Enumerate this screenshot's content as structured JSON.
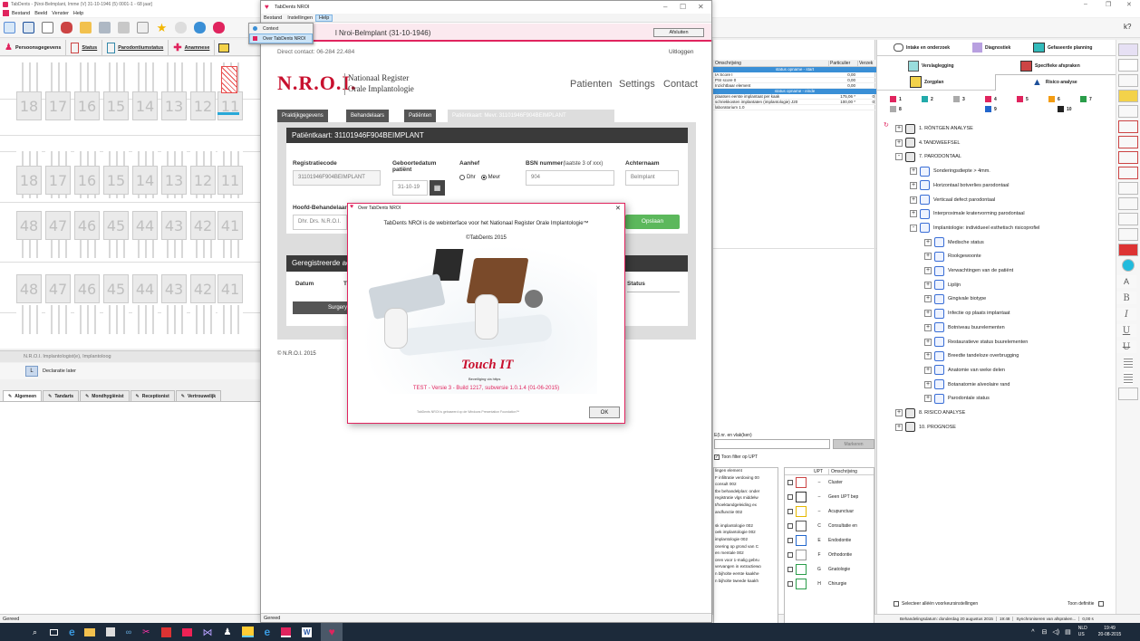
{
  "main_window": {
    "title": "TabDents - [Nroi-Belmplant, Imme (V) 31-10-1946 (5) 0001-1 - 68 jaar]",
    "menu": [
      "Bestand",
      "Beeld",
      "Venster",
      "Help"
    ],
    "tabs": [
      {
        "label": "Persoonsgegevens"
      },
      {
        "label": "Status"
      },
      {
        "label": "Parodontiumstatus"
      },
      {
        "label": "Anamnese"
      }
    ],
    "upper_teeth": [
      "18",
      "17",
      "16",
      "15",
      "14",
      "13",
      "12",
      "11"
    ],
    "lower_teeth": [
      "48",
      "47",
      "46",
      "45",
      "44",
      "43",
      "42",
      "41"
    ],
    "mid_upper_teeth": [
      "18",
      "17",
      "16",
      "15",
      "14",
      "13",
      "12",
      "11"
    ],
    "mid_lower_teeth": [
      "48",
      "47",
      "46",
      "45",
      "44",
      "43",
      "42",
      "41"
    ],
    "practitioner": "N.R.O.I. Implantologist(e), Implantoloog",
    "declaratie_badge": "L",
    "declaratie_label": "Declaratie later",
    "bottom_tabs": [
      "Algemeen",
      "Tandarts",
      "Mondhygiënist",
      "Receptionist",
      "Vertrouwelijk"
    ],
    "status": "Gereed"
  },
  "right_panel": {
    "top_tabs": [
      "Intake en onderzoek",
      "Diagnostiek",
      "Gefaseerde planning"
    ],
    "second_tabs": [
      "Verslaglegging",
      "Specifieke afspraken"
    ],
    "third_tabs": [
      "Zorgplan",
      "Risico analyse"
    ],
    "counters": [
      {
        "icon": "red",
        "value": "1"
      },
      {
        "icon": "teal",
        "value": "2"
      },
      {
        "icon": "grey",
        "value": "3"
      },
      {
        "icon": "red",
        "value": "4"
      },
      {
        "icon": "red",
        "value": "5"
      },
      {
        "icon": "orange",
        "value": "6"
      },
      {
        "icon": "green",
        "value": "7"
      },
      {
        "icon": "grey",
        "value": "8"
      },
      {
        "icon": "blue",
        "value": "9"
      },
      {
        "icon": "black",
        "value": "10"
      }
    ],
    "tree": [
      {
        "label": "1. RÖNTGEN ANALYSE",
        "level": 0,
        "sign": "+"
      },
      {
        "label": "4.TANDWEEFSEL",
        "level": 0,
        "sign": "+"
      },
      {
        "label": "7. PARODONTAAL",
        "level": 0,
        "sign": "-"
      },
      {
        "label": "Sonderingsdiepte > 4mm.",
        "level": 1,
        "sign": "+"
      },
      {
        "label": "Horizontaal botverlies parodontaal",
        "level": 1,
        "sign": "+"
      },
      {
        "label": "Verticaal defect parodontaal",
        "level": 1,
        "sign": "+"
      },
      {
        "label": "Interproximale kratervorming parodontaal",
        "level": 1,
        "sign": "+"
      },
      {
        "label": "Implantologie: individueel esthetisch risicoprofiel",
        "level": 1,
        "sign": "-"
      },
      {
        "label": "Medische status",
        "level": 2,
        "sign": "+"
      },
      {
        "label": "Rookgewoonte",
        "level": 2,
        "sign": "+"
      },
      {
        "label": "Verwachtingen van de patiënt",
        "level": 2,
        "sign": "+"
      },
      {
        "label": "Liplijn",
        "level": 2,
        "sign": "+"
      },
      {
        "label": "Gingivale biotype",
        "level": 2,
        "sign": "+"
      },
      {
        "label": "Infectie op plaats implantaat",
        "level": 2,
        "sign": "+"
      },
      {
        "label": "Botniveau buurelementen",
        "level": 2,
        "sign": "+"
      },
      {
        "label": "Restauratieve status buurelementen",
        "level": 2,
        "sign": "+"
      },
      {
        "label": "Breedte tandeloze overbrugging",
        "level": 2,
        "sign": "+"
      },
      {
        "label": "Anatomie van weke delen",
        "level": 2,
        "sign": "+"
      },
      {
        "label": "Botanatomie alveolaire rand",
        "level": 2,
        "sign": "+"
      },
      {
        "label": "Parodontale status",
        "level": 2,
        "sign": "+"
      },
      {
        "label": "8. RISICO ANALYSE",
        "level": 0,
        "sign": "+"
      },
      {
        "label": "10. PROGNOSE",
        "level": 0,
        "sign": "+"
      }
    ],
    "checkbox_label": "Selecteer alléén voorkeursinstellingen",
    "toon_definitie": "Toon definitie"
  },
  "mid_panel": {
    "table_headers": [
      "Omschrijving",
      "Particulier",
      "Verzek"
    ],
    "table_rows": [
      {
        "desc": "status opname - start",
        "p": "",
        "v": "",
        "kind": "band"
      },
      {
        "desc": "IA Score I",
        "p": "0,00",
        "v": "",
        "kind": "row"
      },
      {
        "desc": "PSI score 0",
        "p": "0,00",
        "v": "",
        "kind": "row"
      },
      {
        "desc": "Inzichtbaar element",
        "p": "0,00",
        "v": "",
        "kind": "row"
      },
      {
        "desc": "status opname - einde",
        "p": "",
        "v": "",
        "kind": "band"
      },
      {
        "desc": "plaatsen eerste implantaat per kaak",
        "p": "175,06 *",
        "v": "0",
        "kind": "row"
      },
      {
        "desc": "schriekkosten implantaten (implantologie) J20",
        "p": "100,00 *",
        "v": "0",
        "kind": "row"
      },
      {
        "desc": "laboratorium 1.0",
        "p": "",
        "v": "",
        "kind": "row"
      }
    ],
    "search_label": "E(l.nr. en vlak(ken)",
    "markeren_button": "Markeren",
    "toon_filter": "Toon filter op UPT",
    "list_items": [
      "lingen element",
      "F infiltratie verdoving 00",
      "consult 002",
      "tbv behandelplan: onder",
      "registratie vlgs middelw",
      "t/hoektandgeleiding ex",
      "andfunctie 002",
      "",
      "sk implantologie 002",
      "oek implantologie 002",
      "implantologie 002",
      "onering op grond van C",
      "en mentale 002",
      "oren voor 1-malig gebru",
      "vervangen in extractiewo",
      "n bijholte eerste kaakhe",
      "n bijholte tweede kaakh"
    ],
    "upt_header": [
      "UPT",
      "Omschrijving"
    ],
    "upt_items": [
      {
        "code": "–",
        "desc": "Cluster"
      },
      {
        "code": "–",
        "desc": "Geen UPT bep"
      },
      {
        "code": "–",
        "desc": "Acupunctuur"
      },
      {
        "code": "C",
        "desc": "Consultatie en"
      },
      {
        "code": "E",
        "desc": "Endodontie"
      },
      {
        "code": "F",
        "desc": "Orthodontie"
      },
      {
        "code": "G",
        "desc": "Gnatologie"
      },
      {
        "code": "H",
        "desc": "Chirurgie"
      }
    ]
  },
  "browser": {
    "title": "TabDents NROI",
    "menu": [
      "Bestand",
      "Instellingen",
      "Help"
    ],
    "help_menu_items": [
      "Context",
      "Over TabDents NROI"
    ],
    "header_title": "l Nroi-Belmplant  (31-10-1946)",
    "afsluiten": "Afsluiten",
    "direct_contact": "Direct contact: 06-284 22.484",
    "uitloggen": "Uitloggen",
    "logo": "N.R.O.I.",
    "logo_line1": "Nationaal Register",
    "logo_line2": "Orale Implantologie",
    "nav": [
      "Patienten",
      "Settings",
      "Contact"
    ],
    "tabs": [
      "Praktijkgegevens",
      "Behandelaars",
      "Patiënten",
      "Patiëntkaart: Mevr. 31101946F904BEIMPLANT"
    ],
    "card_title": "Patiëntkaart: 31101946F904BEIMPLANT",
    "reg_label": "Registratiecode",
    "reg_value": "31101946F904BEIMPLANT",
    "geb_label": "Geboortedatum patiënt",
    "geb_value": "31-10-19",
    "aanhef_label": "Aanhef",
    "aanhef_options": [
      "Dhr",
      "Mevr"
    ],
    "bsn_label": "BSN nummer",
    "bsn_hint": "(laatste 3 of xxx)",
    "bsn_value": "904",
    "achternaam_label": "Achternaam",
    "achternaam_value": "Belmplant",
    "hoofd_label": "Hoofd-Behandelaar",
    "hoofd_value": "Dhr. Drs. N.R.O.I.",
    "opslaan": "Opslaan",
    "geregistreerde": "Geregistreerde ac",
    "col_datum": "Datum",
    "col_t": "T",
    "col_status": "Status",
    "surgery_btn": "Surgery",
    "footer": "© N.R.O.I. 2015",
    "status": "Gereed"
  },
  "dialog": {
    "title": "Over TabDents NROI",
    "line1": "TabDents NROI is de webinterface voor het Nationaal Register Orale Implantologie™",
    "line2": "©TabDents 2015",
    "touch_it": "Touch IT",
    "touch_sub": "Beveiliging via https",
    "version": "TEST - Versie 3 - Build 1217, subversie 1.0.1.4 (01-06-2015)",
    "footer_note": "TabDents NROI is gebaseerd op de Windows Presentation Foundation™",
    "ok": "OK"
  },
  "statusbar_right": {
    "behandel": "Behandelingsdatum: donderdag 20 augustus 2015",
    "time": "19:48",
    "sync": "Synchroniseren van afspraken...",
    "amount": "0,00 s"
  },
  "taskbar": {
    "lang1": "NLD",
    "lang2": "US",
    "clock": "19:49",
    "date": "20-08-2015"
  },
  "colors": {
    "accent_pink": "#e0245e",
    "nroi_red": "#c8102e",
    "tab_dark": "#5a5a5a",
    "green": "#5cb85c",
    "taskbar": "#1c2a3a"
  }
}
